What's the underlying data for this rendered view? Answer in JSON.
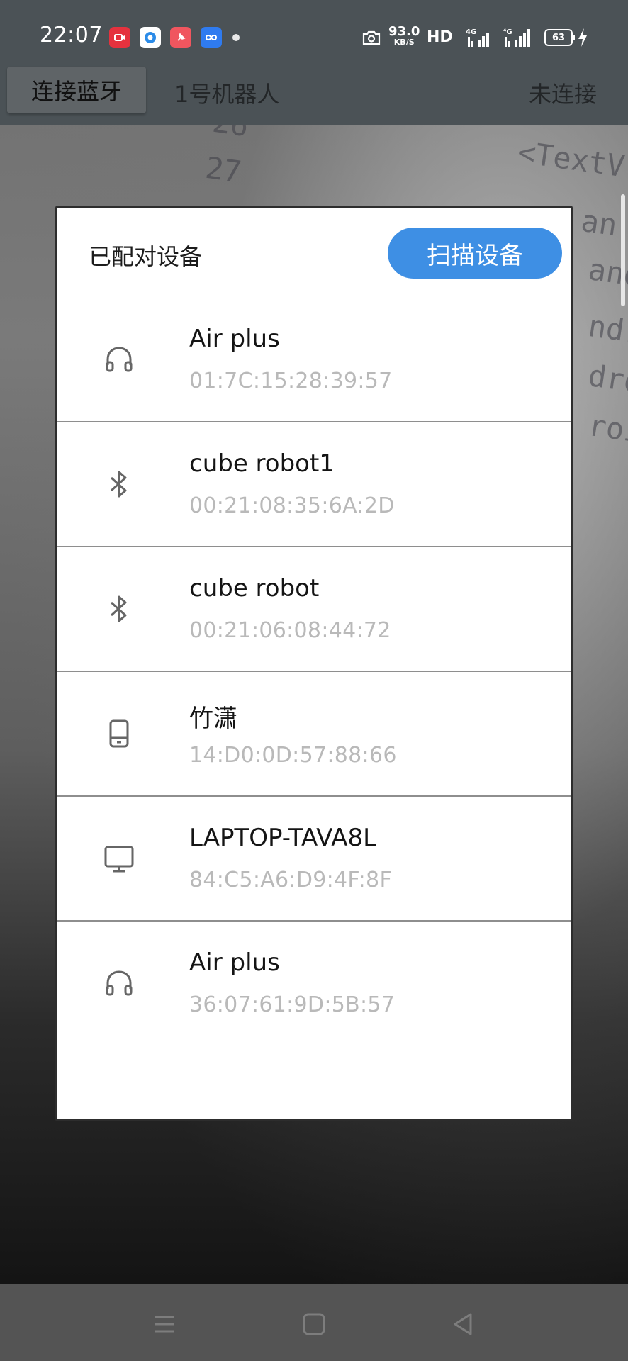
{
  "status_bar": {
    "time": "22:07",
    "net_speed_value": "93.0",
    "net_speed_unit": "KB/S",
    "hd_label": "HD",
    "battery_level": "63",
    "app_icons": [
      "screen-record-icon",
      "browser-icon",
      "pin-icon",
      "infinity-icon"
    ],
    "right_icons": [
      "camera-icon",
      "signal-4g-icon",
      "signal-4g-icon",
      "charging-icon"
    ]
  },
  "header": {
    "connect_button": "连接蓝牙",
    "robot_name": "1号机器人",
    "connection_status": "未连接"
  },
  "dialog": {
    "title": "已配对设备",
    "scan_button": "扫描设备",
    "devices": [
      {
        "icon": "headphones-icon",
        "name": "Air plus",
        "address": "01:7C:15:28:39:57"
      },
      {
        "icon": "bluetooth-icon",
        "name": "cube robot1",
        "address": "00:21:08:35:6A:2D"
      },
      {
        "icon": "bluetooth-icon",
        "name": "cube robot",
        "address": "00:21:06:08:44:72"
      },
      {
        "icon": "tablet-icon",
        "name": "竹潇",
        "address": "14:D0:0D:57:88:66"
      },
      {
        "icon": "monitor-icon",
        "name": "LAPTOP-TAVA8L",
        "address": "84:C5:A6:D9:4F:8F"
      },
      {
        "icon": "headphones-icon",
        "name": "Air plus",
        "address": "36:07:61:9D:5B:57"
      }
    ]
  },
  "nav_bar": {
    "buttons": [
      "menu-icon",
      "home-icon",
      "back-icon"
    ]
  },
  "colors": {
    "accent": "#3e8fe4",
    "app_bar": "#4b5256",
    "address_text": "#b9b9b9"
  }
}
